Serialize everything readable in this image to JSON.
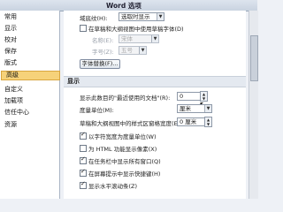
{
  "window": {
    "title": "Word 选项"
  },
  "sidebar": {
    "items": [
      {
        "label": "常用"
      },
      {
        "label": "显示"
      },
      {
        "label": "校对"
      },
      {
        "label": "保存"
      },
      {
        "label": "版式"
      },
      {
        "label": "高级"
      },
      {
        "label": "自定义"
      },
      {
        "label": "加载项"
      },
      {
        "label": "信任中心"
      },
      {
        "label": "资源"
      }
    ],
    "active_index": 5
  },
  "top": {
    "field_shading_label": "域底纹(H):",
    "field_shading_value": "选取时显示",
    "draft_font_label": "在草稿和大纲视图中使用草稿字体(D)",
    "name_label": "名称(E):",
    "name_value": "宋体",
    "size_label": "字号(Z):",
    "size_value": "五号",
    "font_sub_button": "字体替换(F)..."
  },
  "display": {
    "section_title": "显示",
    "recent_docs_label": "显示此数目的\"最近使用的文档\"(R):",
    "recent_docs_value": "0",
    "units_label": "度量单位(M):",
    "units_value": "厘米",
    "draft_style_width_label": "草稿和大纲视图中的样式区窗格宽度(E):",
    "draft_style_width_value": "0 厘米",
    "options": [
      {
        "label": "以字符宽度为度量单位(W)",
        "checked": true
      },
      {
        "label": "为 HTML 功能显示像素(X)",
        "checked": false
      },
      {
        "label": "在任务栏中显示所有窗口(Q)",
        "checked": true
      },
      {
        "label": "在屏幕提示中显示快捷键(H)",
        "checked": true
      },
      {
        "label": "显示水平滚动条(Z)",
        "checked": true
      }
    ]
  }
}
